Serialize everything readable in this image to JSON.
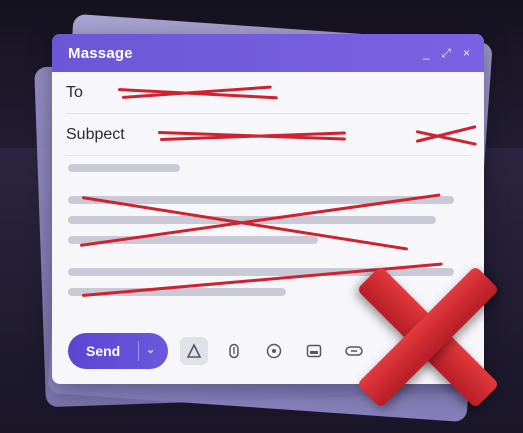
{
  "window": {
    "title": "Massage",
    "controls": [
      "_",
      "⤢",
      "×"
    ]
  },
  "fields": {
    "to_label": "To",
    "subject_label": "Subpect"
  },
  "toolbar": {
    "send_label": "Send",
    "send_menu": "⌄",
    "tools": [
      {
        "icon": "text-format-icon",
        "glyph": "A"
      },
      {
        "icon": "attach-icon",
        "glyph": "📎"
      },
      {
        "icon": "emoji-icon",
        "glyph": "☺"
      },
      {
        "icon": "image-icon",
        "glyph": "▣"
      },
      {
        "icon": "link-icon",
        "glyph": "⊂⊃"
      }
    ]
  },
  "colors": {
    "accent": "#6b57d6",
    "redaction": "#cf2230",
    "big_x": "#d82d33",
    "background": "#1d1a2c"
  }
}
